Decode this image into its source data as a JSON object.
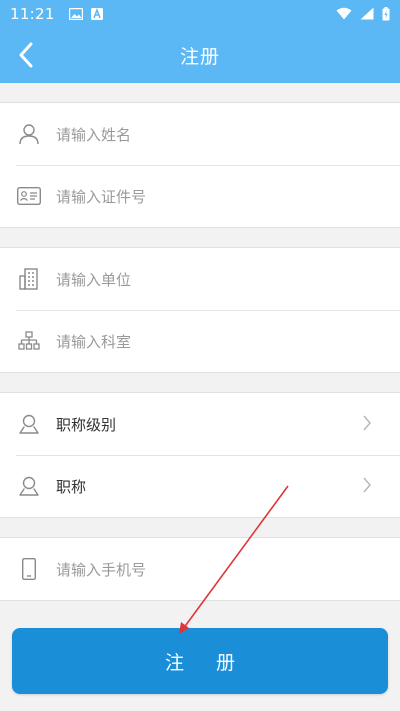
{
  "status_bar": {
    "time": "11:21",
    "icons": [
      "image-icon",
      "a-icon",
      "wifi-icon",
      "signal-icon",
      "battery-icon"
    ]
  },
  "app_bar": {
    "title": "注册",
    "back_icon": "chevron-left-icon"
  },
  "form": {
    "name": {
      "placeholder": "请输入姓名",
      "icon": "user-icon"
    },
    "id_number": {
      "placeholder": "请输入证件号",
      "icon": "id-card-icon"
    },
    "unit": {
      "placeholder": "请输入单位",
      "icon": "building-icon"
    },
    "department": {
      "placeholder": "请输入科室",
      "icon": "org-chart-icon"
    },
    "title_level": {
      "label": "职称级别",
      "icon": "profile-icon"
    },
    "title": {
      "label": "职称",
      "icon": "profile-icon"
    },
    "phone": {
      "placeholder": "请输入手机号",
      "icon": "phone-icon"
    }
  },
  "submit_button": {
    "label": "注册"
  },
  "colors": {
    "header": "#5bb8f5",
    "button": "#1a8fd8",
    "annotation_arrow": "#e0333a"
  }
}
